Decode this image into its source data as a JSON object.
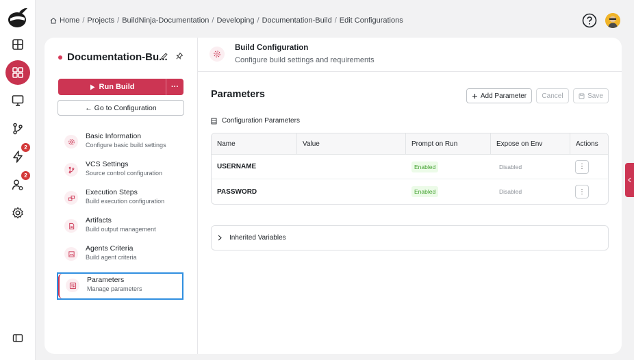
{
  "breadcrumb": {
    "items": [
      "Home",
      "Projects",
      "BuildNinja-Documentation",
      "Developing",
      "Documentation-Build",
      "Edit Configurations"
    ],
    "separator": "/"
  },
  "rail": {
    "badges": {
      "builds": "2",
      "agents": "2"
    }
  },
  "sidebar": {
    "build_name": "Documentation-Bu...",
    "run_label": "Run Build",
    "run_more": "···",
    "goto_label": "← Go to Configuration",
    "items": [
      {
        "title": "Basic Information",
        "subtitle": "Configure basic build settings"
      },
      {
        "title": "VCS Settings",
        "subtitle": "Source control configuration"
      },
      {
        "title": "Execution Steps",
        "subtitle": "Build execution configuration"
      },
      {
        "title": "Artifacts",
        "subtitle": "Build output management"
      },
      {
        "title": "Agents Criteria",
        "subtitle": "Build agent criteria"
      },
      {
        "title": "Parameters",
        "subtitle": "Manage parameters"
      }
    ]
  },
  "header": {
    "title": "Build Configuration",
    "subtitle": "Configure build settings and requirements"
  },
  "params": {
    "title": "Parameters",
    "add_label": "Add Parameter",
    "cancel_label": "Cancel",
    "save_label": "Save",
    "section_label": "Configuration Parameters",
    "columns": [
      "Name",
      "Value",
      "Prompt on Run",
      "Expose on Env",
      "Actions"
    ],
    "rows": [
      {
        "name": "USERNAME",
        "value": "",
        "prompt": "Enabled",
        "expose": "Disabled"
      },
      {
        "name": "PASSWORD",
        "value": "",
        "prompt": "Enabled",
        "expose": "Disabled"
      }
    ],
    "inherited_label": "Inherited Variables"
  },
  "colors": {
    "accent": "#cc3553",
    "selection": "#2f8fe0",
    "enabled": "#42a12f"
  }
}
